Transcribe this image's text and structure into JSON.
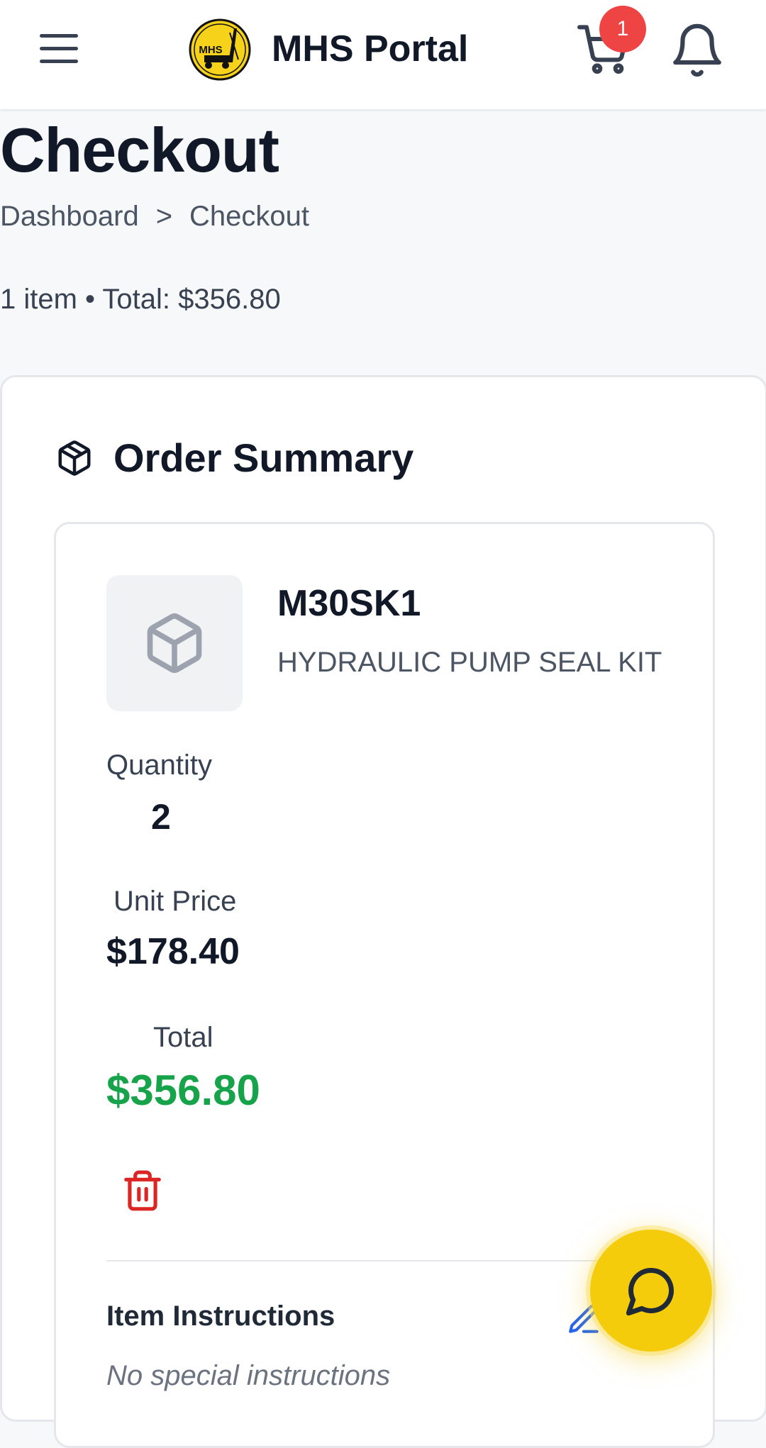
{
  "header": {
    "app_title": "MHS Portal",
    "logo_text": "MHS",
    "cart_count": "1"
  },
  "page": {
    "title": "Checkout",
    "breadcrumb": [
      "Dashboard",
      ">",
      "Checkout"
    ],
    "summary_line": "1 item • Total: $356.80"
  },
  "order_summary": {
    "title": "Order Summary",
    "item": {
      "sku": "M30SK1",
      "name": "HYDRAULIC PUMP SEAL KIT",
      "quantity_label": "Quantity",
      "quantity": "2",
      "unit_price_label": "Unit Price",
      "unit_price": "$178.40",
      "total_label": "Total",
      "total": "$356.80"
    },
    "instructions": {
      "title": "Item Instructions",
      "text": "No special instructions"
    }
  },
  "colors": {
    "accent": "#f4cc0b",
    "total_green": "#16a34a",
    "danger": "#dc2626",
    "badge": "#ef4444"
  },
  "icons": [
    "menu-icon",
    "logo",
    "cart-icon",
    "bell-icon",
    "package-icon",
    "trash-icon",
    "edit-icon",
    "chat-icon"
  ]
}
